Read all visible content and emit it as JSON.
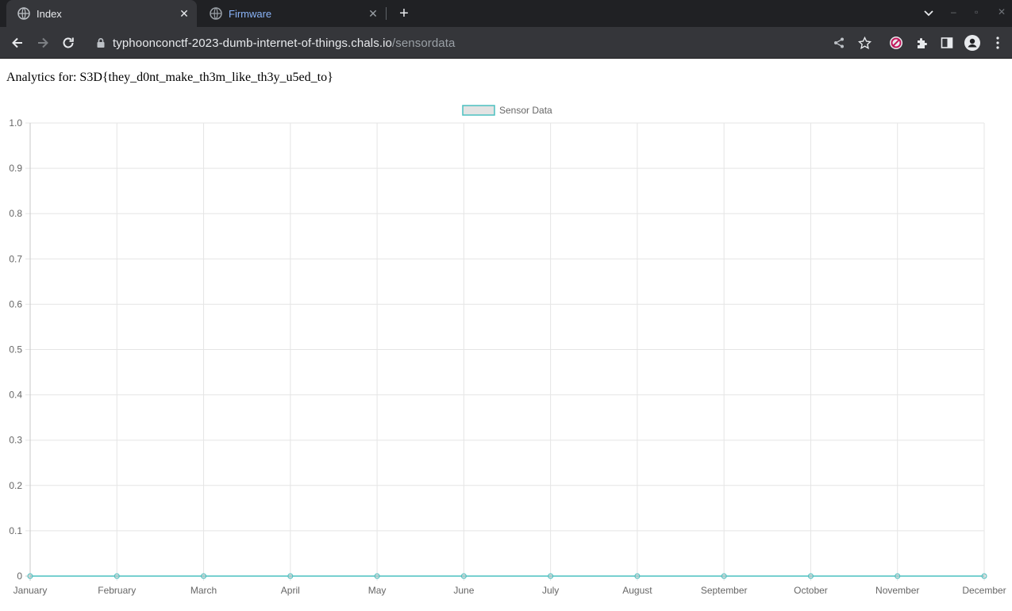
{
  "browser": {
    "tabs": [
      {
        "title": "Index",
        "active": true
      },
      {
        "title": "Firmware",
        "active": false
      }
    ],
    "url_host": "typhoonconctf-2023-dumb-internet-of-things.chals.io",
    "url_path": "/sensordata"
  },
  "page": {
    "heading": "Analytics for: S3D{they_d0nt_make_th3m_like_th3y_u5ed_to}"
  },
  "chart_data": {
    "type": "line",
    "categories": [
      "January",
      "February",
      "March",
      "April",
      "May",
      "June",
      "July",
      "August",
      "September",
      "October",
      "November",
      "December"
    ],
    "series": [
      {
        "name": "Sensor Data",
        "values": [
          0,
          0,
          0,
          0,
          0,
          0,
          0,
          0,
          0,
          0,
          0,
          0
        ],
        "color": "#4bc0c0"
      }
    ],
    "yticks": [
      "0",
      "0.1",
      "0.2",
      "0.3",
      "0.4",
      "0.5",
      "0.6",
      "0.7",
      "0.8",
      "0.9",
      "1.0"
    ],
    "ylim": [
      0,
      1
    ],
    "grid": true,
    "legend_position": "top-center"
  }
}
